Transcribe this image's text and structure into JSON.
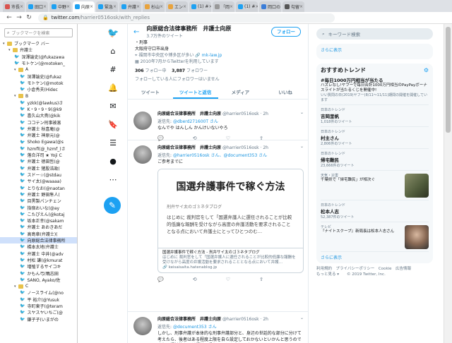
{
  "tabs": [
    {
      "label": "市長",
      "color": "#d9534f"
    },
    {
      "label": "田口",
      "color": "#1da1f2"
    },
    {
      "label": "中野",
      "color": "#1da1f2"
    },
    {
      "label": "向原",
      "color": "#1da1f2",
      "active": true
    },
    {
      "label": "緊急",
      "color": "#1da1f2"
    },
    {
      "label": "弁護",
      "color": "#1da1f2"
    },
    {
      "label": "杉山",
      "color": "#e8a33d"
    },
    {
      "label": "エン",
      "color": "#e8a33d"
    },
    {
      "label": "(1) #",
      "color": "#1da1f2"
    },
    {
      "label": "「岡",
      "color": "#999999"
    },
    {
      "label": "(1) #",
      "color": "#1da1f2"
    },
    {
      "label": "岡口の",
      "color": "#3b7dd8"
    },
    {
      "label": "勾留",
      "color": "#555555"
    }
  ],
  "omnibox": {
    "host": "twitter.com",
    "path": "/harrier0516osk/with_replies"
  },
  "bookmarks": {
    "search_placeholder": "ブックマークを検索",
    "rows": [
      {
        "text": "ブックマーク バー",
        "type": "folder",
        "depth": 0
      },
      {
        "text": "弁護士",
        "type": "folder",
        "depth": 1
      },
      {
        "text": "深澤諭史(@fukazawa",
        "type": "tw",
        "depth": 2
      },
      {
        "text": "モトケン(@motoken_",
        "type": "tw",
        "depth": 2
      },
      {
        "text": "A",
        "type": "folder",
        "depth": 2
      },
      {
        "text": "深澤諭史(@fukaz",
        "type": "tw",
        "depth": 3
      },
      {
        "text": "モトケン(@motok",
        "type": "tw",
        "depth": 3
      },
      {
        "text": "小倉秀夫(Hidec",
        "type": "tw",
        "depth": 3
      },
      {
        "text": "B",
        "type": "folder",
        "depth": 2
      },
      {
        "text": "yzkk(@lawkus)さ",
        "type": "tw",
        "depth": 3
      },
      {
        "text": "K・9・9・9(@k9",
        "type": "tw",
        "depth": 3
      },
      {
        "text": "喜久山大貴(@kik",
        "type": "tw",
        "depth": 3
      },
      {
        "text": "ココテン刑事被害",
        "type": "tw",
        "depth": 3
      },
      {
        "text": "弁護士 秋喜庵(@",
        "type": "tw",
        "depth": 3
      },
      {
        "text": "弁護士 神原元(@",
        "type": "tw",
        "depth": 3
      },
      {
        "text": "Shoko Egawa(@s",
        "type": "tw",
        "depth": 3
      },
      {
        "text": "hzmfl(@_hzmf_)さ",
        "type": "tw",
        "depth": 3
      },
      {
        "text": "落合洋司 ★ Yoji C",
        "type": "tw",
        "depth": 3
      },
      {
        "text": "弁護士 徳田哲(@",
        "type": "tw",
        "depth": 3
      },
      {
        "text": "弁護士 猪股浩政(",
        "type": "tw",
        "depth": 3
      },
      {
        "text": "スドー☆(@stdau",
        "type": "tw",
        "depth": 3
      },
      {
        "text": "サイ太(@waaaa)",
        "type": "tw",
        "depth": 3
      },
      {
        "text": "とりなお(@naotan",
        "type": "tw",
        "depth": 3
      },
      {
        "text": "弁護士 野田隼人(",
        "type": "tw",
        "depth": 3
      },
      {
        "text": "目黒製パンチェン",
        "type": "tw",
        "depth": 3
      },
      {
        "text": "指宿おいな(@ay",
        "type": "tw",
        "depth": 3
      },
      {
        "text": "こたぴえん(@kotaj",
        "type": "tw",
        "depth": 3
      },
      {
        "text": "坂本正幸(@sakam",
        "type": "tw",
        "depth": 3
      },
      {
        "text": "弁護士 あおきあだ",
        "type": "tw",
        "depth": 3
      },
      {
        "text": "高島章(弁護士)(",
        "type": "tw",
        "depth": 3
      },
      {
        "text": "向原総合法律事務所",
        "type": "tw",
        "depth": 3,
        "selected": true
      },
      {
        "text": "橋本太地(弁護士",
        "type": "tw",
        "depth": 3
      },
      {
        "text": "弁護士 中井(@adv",
        "type": "tw",
        "depth": 3
      },
      {
        "text": "村松 謙(@kmurat",
        "type": "tw",
        "depth": 3
      },
      {
        "text": "増殖するサイコキ",
        "type": "tw",
        "depth": 3
      },
      {
        "text": "かもん弓(鴨志田",
        "type": "tw",
        "depth": 3
      },
      {
        "text": "SANO, Ayako/佐",
        "type": "tw",
        "depth": 3
      },
      {
        "text": "C",
        "type": "folder",
        "depth": 2
      },
      {
        "text": "ノースライム(@no",
        "type": "tw",
        "depth": 3
      },
      {
        "text": "平 裕介(@Yusuk",
        "type": "tw",
        "depth": 3
      },
      {
        "text": "寺町東子(@teram",
        "type": "tw",
        "depth": 3
      },
      {
        "text": "スヤスヤいちご(@",
        "type": "tw",
        "depth": 3
      },
      {
        "text": "鎌子子(いまがの",
        "type": "tw",
        "depth": 3
      }
    ]
  },
  "main": {
    "header_name": "向原総合法律事務所　井護士向原",
    "header_sub": "3.7万件のツイート",
    "follow_label": "フォロー",
    "bio_1": "・刑事",
    "bio_2": "大阪府守口市出身",
    "location": "福岡市中央区や博多区が多い",
    "website": "mk-law.jp",
    "joined": "2010年7月からTwitterを利用しています",
    "following_count": "306",
    "following_label": "フォロー中",
    "followers_count": "3,887",
    "followers_label": "フォロワー",
    "follow_note": "フォローしている人にフォロワーはいません",
    "tabs": [
      "ツイート",
      "ツイートと返信",
      "メディア",
      "いいね"
    ]
  },
  "tweets": [
    {
      "name": "向原総合法律事務所　井護士向原",
      "handle": "@harrier0516osk · 2h",
      "reply_prefix": "返信先:",
      "reply_to": "@dberd271600T さん",
      "body": "なんでや はんしん かんけいないやろ"
    },
    {
      "name": "向原総合法律事務所　井護士向原",
      "handle": "@harrier0516osk · 2h",
      "reply_prefix": "返信先:",
      "reply_to": "@harrier0516osk さん、@document353 さん",
      "body": "ご参考までに",
      "card_title": "国選弁護事件で稼ぐ方法",
      "card_blog": "刑弁サイ太のゴ３ネタブログ",
      "card_excerpt": "はじめに 裁判官をして「国選弁護人に選任されることが比較的低廉な報酬を受けながら高度の弁護活動を要求されることとなる点において弁護士にとってひとつのむ…",
      "card_foot_title": "国選弁護事件で稼ぐ方法 - 刑弁サイ太のゴ３ネタブログ",
      "card_foot_desc": "はじめに 裁判官をして「国選弁護人に選任されることが比較的低廉な報酬を受けながら高度の弁護活動を要求されることとなる点において弁護…",
      "card_foot_domain": "keisaisaita.hatenablog.jp"
    },
    {
      "name": "向原総合法律事務所　井護士向原",
      "handle": "@harrier0516osk · 2h",
      "reply_prefix": "返信先:",
      "reply_to": "@document353 さん",
      "body": "しかし、刑事弁護が本体的な刑事弁護部分と、身辺の世話的な部分に分けて考えたら、後者はある程度上限を自ら設定しておかないといかんと思うのですね。福祉的な面は福祉に委ねることも大切です。"
    }
  ],
  "right": {
    "search_placeholder": "キーワード検索",
    "top_more": "さらに表示",
    "trends_title": "おすすめトレンド",
    "trends": [
      {
        "category": "",
        "name": "#毎日1000万円相当が当たる",
        "desc": "ハズレなし!ヤフーで毎日合計1000万円相当のPayPayボーナスライトが当たるくじを開催中!",
        "sub": "いい質問の日(2019)ヤフー(8/11〜11/11)期間の開催を開催しています"
      },
      {
        "category": "日本のトレンド",
        "name": "吉岡里帆",
        "count": "1,018件のツイート"
      },
      {
        "category": "日本のトレンド",
        "name": "村主さん",
        "count": "2,806件のツイート"
      },
      {
        "category": "日本のトレンド",
        "name": "帰宅難民",
        "count": "23,666件のツイート"
      },
      {
        "category": "天気・災害",
        "name": "千葉県で「帰宅難民」が相次ぐ",
        "count": ""
      },
      {
        "category": "日本のトレンド",
        "name": "松本人志",
        "count": "52,387件のツイート"
      },
      {
        "category": "テレビ",
        "name": "『ナイトスクープ』新局長は松本人志さん",
        "count": ""
      }
    ],
    "more": "さらに表示",
    "footer_1": "利用規約　プライバシーポリシー　Cookie　広告情報",
    "footer_2": "もっと見る ▾　　© 2019 Twitter, Inc."
  }
}
